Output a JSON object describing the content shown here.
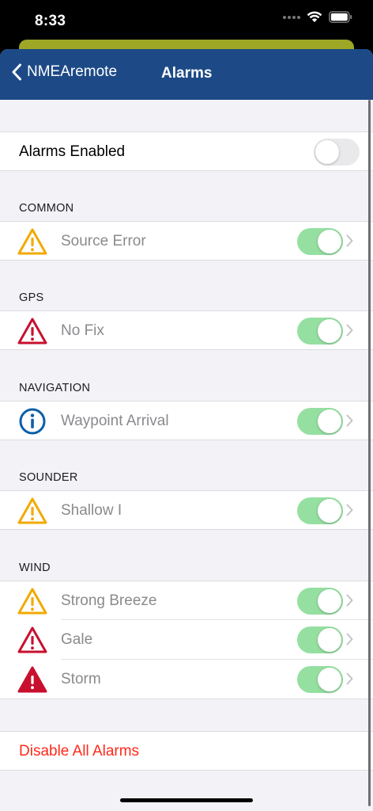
{
  "status_bar": {
    "time": "8:33"
  },
  "nav": {
    "back_label": "NMEAremote",
    "title": "Alarms"
  },
  "alarms_enabled": {
    "label": "Alarms Enabled",
    "on": false
  },
  "sections": [
    {
      "header": "COMMON",
      "items": [
        {
          "label": "Source Error",
          "icon": "warning-triangle-icon",
          "severity": "warning",
          "on": true
        }
      ]
    },
    {
      "header": "GPS",
      "items": [
        {
          "label": "No Fix",
          "icon": "alert-triangle-icon",
          "severity": "alert",
          "on": true
        }
      ]
    },
    {
      "header": "NAVIGATION",
      "items": [
        {
          "label": "Waypoint Arrival",
          "icon": "info-circle-icon",
          "severity": "info",
          "on": true
        }
      ]
    },
    {
      "header": "SOUNDER",
      "items": [
        {
          "label": "Shallow I",
          "icon": "warning-triangle-icon",
          "severity": "warning",
          "on": true
        }
      ]
    },
    {
      "header": "WIND",
      "items": [
        {
          "label": "Strong Breeze",
          "icon": "warning-triangle-icon",
          "severity": "warning",
          "on": true
        },
        {
          "label": "Gale",
          "icon": "alert-triangle-icon",
          "severity": "alert",
          "on": true
        },
        {
          "label": "Storm",
          "icon": "alarm-triangle-icon",
          "severity": "alarm",
          "on": true
        }
      ]
    }
  ],
  "disable_all": {
    "label": "Disable All Alarms"
  },
  "colors": {
    "nav_background": "#1d4a86",
    "toggle_on": "#95e0a1",
    "warning": "#f2a900",
    "alert": "#c8102e",
    "info": "#0a5fa8",
    "danger_text": "#ff2a1a"
  }
}
